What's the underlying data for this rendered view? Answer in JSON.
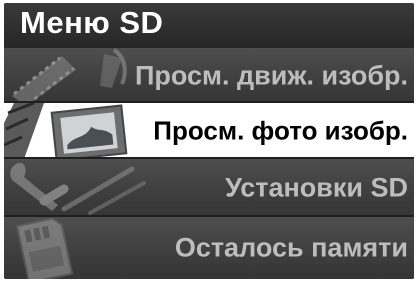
{
  "header": {
    "title": "Меню SD"
  },
  "menu": {
    "items": [
      {
        "label": "Просм. движ. изобр.",
        "icon": "film-strip-icon",
        "selected": false
      },
      {
        "label": "Просм. фото изобр.",
        "icon": "photo-frame-icon",
        "selected": true
      },
      {
        "label": "Установки SD",
        "icon": "tools-icon",
        "selected": false
      },
      {
        "label": "Осталось памяти",
        "icon": "sd-card-icon",
        "selected": false
      }
    ]
  },
  "colors": {
    "background": "#2d2d2d",
    "header_text": "#ffffff",
    "item_text": "#bdbdbd",
    "selected_background": "#ffffff",
    "selected_text": "#000000"
  }
}
